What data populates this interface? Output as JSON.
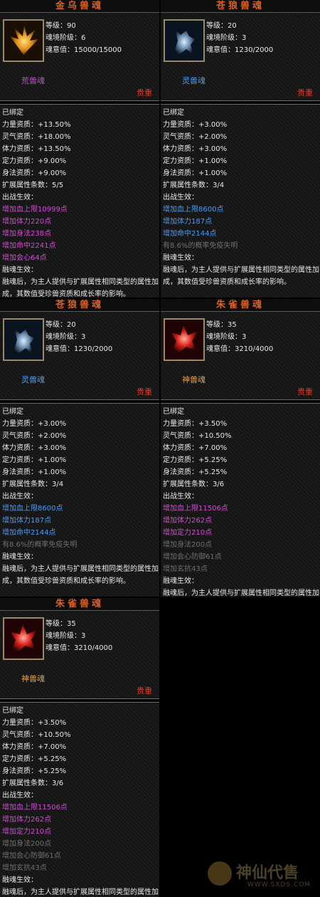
{
  "cards": [
    {
      "title": "金乌兽魂",
      "level": "等级：90",
      "stage": "魂境阶级：6",
      "soul": "魂意值：15000/15000",
      "type": "荒兽魂",
      "type_color": "#c44bd4",
      "rarity": "贵重",
      "bound": "已绑定",
      "stats": [
        "力量资质：+13.50%",
        "灵气资质：+18.00%",
        "体力资质：+13.50%",
        "定力资质：+9.00%",
        "身法资质：+9.00%"
      ],
      "ext_count": "扩展属性条数：5/5",
      "battle_label": "出战生效：",
      "battle": [
        {
          "text": "增加血上限10999点",
          "color": "pink"
        },
        {
          "text": "增加体力220点",
          "color": "pink"
        },
        {
          "text": "增加身法238点",
          "color": "pink"
        },
        {
          "text": "增加命中2241点",
          "color": "pink"
        },
        {
          "text": "增加会心64点",
          "color": "pink"
        }
      ],
      "fuse_label": "融魂生效：",
      "fuse_text": "融魂后，为主人提供与扩展属性相同类型的属性加成，其数值受珍兽资质和成长率的影响。"
    },
    {
      "title": "苍狼兽魂",
      "level": "等级：20",
      "stage": "魂境阶级：3",
      "soul": "魂意值：1230/2000",
      "type": "灵兽魂",
      "type_color": "#4a9cf0",
      "rarity": "贵重",
      "bound": "已绑定",
      "stats": [
        "力量资质：+3.00%",
        "灵气资质：+2.00%",
        "体力资质：+3.00%",
        "定力资质：+1.00%",
        "身法资质：+1.00%"
      ],
      "ext_count": "扩展属性条数：3/4",
      "battle_label": "出战生效：",
      "battle": [
        {
          "text": "增加血上限8600点",
          "color": "blue"
        },
        {
          "text": "增加体力187点",
          "color": "blue"
        },
        {
          "text": "增加命中2144点",
          "color": "blue"
        },
        {
          "text": "有8.6%的概率免疫失明",
          "color": "gray"
        }
      ],
      "fuse_label": "融魂生效：",
      "fuse_text": "融魂后，为主人提供与扩展属性相同类型的属性加成，其数值受珍兽资质和成长率的影响。"
    },
    {
      "title": "苍狼兽魂",
      "level": "等级：20",
      "stage": "魂境阶级：3",
      "soul": "魂意值：1230/2000",
      "type": "灵兽魂",
      "type_color": "#4a9cf0",
      "rarity": "贵重",
      "bound": "已绑定",
      "stats": [
        "力量资质：+3.00%",
        "灵气资质：+2.00%",
        "体力资质：+3.00%",
        "定力资质：+1.00%",
        "身法资质：+1.00%"
      ],
      "ext_count": "扩展属性条数：3/4",
      "battle_label": "出战生效：",
      "battle": [
        {
          "text": "增加血上限8600点",
          "color": "blue"
        },
        {
          "text": "增加体力187点",
          "color": "blue"
        },
        {
          "text": "增加命中2144点",
          "color": "blue"
        },
        {
          "text": "有8.6%的概率免疫失明",
          "color": "gray"
        }
      ],
      "fuse_label": "融魂生效：",
      "fuse_text": "融魂后，为主人提供与扩展属性相同类型的属性加成，其数值受珍兽资质和成长率的影响。"
    },
    {
      "title": "朱雀兽魂",
      "level": "等级：35",
      "stage": "魂境阶级：3",
      "soul": "魂意值：3210/4000",
      "type": "神兽魂",
      "type_color": "#e8a040",
      "rarity": "贵重",
      "bound": "已绑定",
      "stats": [
        "力量资质：+3.50%",
        "灵气资质：+10.50%",
        "体力资质：+7.00%",
        "定力资质：+5.25%",
        "身法资质：+5.25%"
      ],
      "ext_count": "扩展属性条数：3/6",
      "battle_label": "出战生效：",
      "battle": [
        {
          "text": "增加血上限11506点",
          "color": "pink"
        },
        {
          "text": "增加体力262点",
          "color": "pink"
        },
        {
          "text": "增加定力210点",
          "color": "pink"
        },
        {
          "text": "增加身法200点",
          "color": "gray"
        },
        {
          "text": "增加会心防御61点",
          "color": "gray"
        },
        {
          "text": "增加玄抗43点",
          "color": "gray"
        }
      ],
      "fuse_label": "融魂生效：",
      "fuse_text": "融魂后，为主人提供与扩展属性相同类型的属性加成，其数值受珍兽资质和成长率的影响。"
    },
    {
      "title": "朱雀兽魂",
      "level": "等级：35",
      "stage": "魂境阶级：3",
      "soul": "魂意值：3210/4000",
      "type": "神兽魂",
      "type_color": "#e8a040",
      "rarity": "贵重",
      "bound": "已绑定",
      "stats": [
        "力量资质：+3.50%",
        "灵气资质：+10.50%",
        "体力资质：+7.00%",
        "定力资质：+5.25%",
        "身法资质：+5.25%"
      ],
      "ext_count": "扩展属性条数：3/6",
      "battle_label": "出战生效：",
      "battle": [
        {
          "text": "增加血上限11506点",
          "color": "pink"
        },
        {
          "text": "增加体力262点",
          "color": "pink"
        },
        {
          "text": "增加定力210点",
          "color": "pink"
        },
        {
          "text": "增加身法200点",
          "color": "gray"
        },
        {
          "text": "增加会心防御61点",
          "color": "gray"
        },
        {
          "text": "增加玄抗43点",
          "color": "gray"
        }
      ],
      "fuse_label": "融魂生效：",
      "fuse_text": "融魂后，为主人提供与扩展属性相同类型的属性加成，其数值受珍兽资质和成长率的影响。"
    }
  ],
  "watermark": {
    "name": "神仙代售",
    "url": "WWW.SXDS.COM"
  }
}
